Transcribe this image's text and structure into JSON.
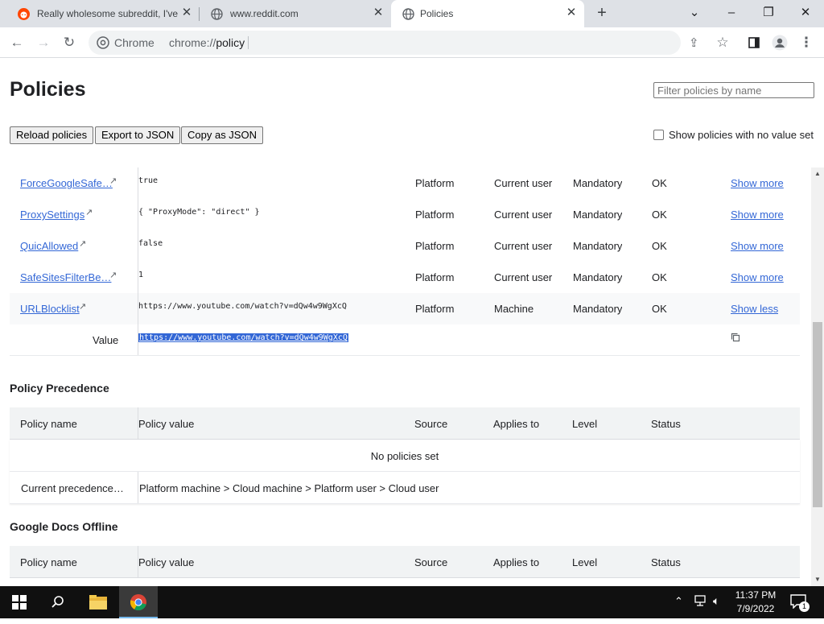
{
  "browser": {
    "tabs": [
      {
        "title": "Really wholesome subreddit, I've",
        "icon": "reddit-icon"
      },
      {
        "title": "www.reddit.com",
        "icon": "globe-icon"
      },
      {
        "title": "Policies",
        "icon": "globe-icon",
        "active": true
      }
    ],
    "omnibox": {
      "site_label": "Chrome",
      "url_prefix": "chrome://",
      "url_path": "policy"
    }
  },
  "page": {
    "title": "Policies",
    "filter_placeholder": "Filter policies by name",
    "buttons": {
      "reload": "Reload policies",
      "export": "Export to JSON",
      "copy": "Copy as JSON"
    },
    "show_no_value_label": "Show policies with no value set",
    "policies": [
      {
        "name": "ForceGoogleSafe…",
        "value": "true",
        "source": "Platform",
        "applies": "Current user",
        "level": "Mandatory",
        "status": "OK",
        "action": "Show more"
      },
      {
        "name": "ProxySettings",
        "value": "{ \"ProxyMode\": \"direct\" }",
        "source": "Platform",
        "applies": "Current user",
        "level": "Mandatory",
        "status": "OK",
        "action": "Show more"
      },
      {
        "name": "QuicAllowed",
        "value": "false",
        "source": "Platform",
        "applies": "Current user",
        "level": "Mandatory",
        "status": "OK",
        "action": "Show more"
      },
      {
        "name": "SafeSitesFilterBe…",
        "value": "1",
        "source": "Platform",
        "applies": "Current user",
        "level": "Mandatory",
        "status": "OK",
        "action": "Show more"
      },
      {
        "name": "URLBlocklist",
        "value": "https://www.youtube.com/watch?v=dQw4w9WgXcQ",
        "source": "Platform",
        "applies": "Machine",
        "level": "Mandatory",
        "status": "OK",
        "action": "Show less"
      }
    ],
    "detail": {
      "label": "Value",
      "value": "https://www.youtube.com/watch?v=dQw4w9WgXcQ"
    },
    "precedence": {
      "heading": "Policy Precedence",
      "columns": [
        "Policy name",
        "Policy value",
        "Source",
        "Applies to",
        "Level",
        "Status"
      ],
      "empty_text": "No policies set",
      "current_label": "Current precedence…",
      "current_value": "Platform machine > Cloud machine > Platform user > Cloud user"
    },
    "docs_offline": {
      "heading": "Google Docs Offline",
      "columns": [
        "Policy name",
        "Policy value",
        "Source",
        "Applies to",
        "Level",
        "Status"
      ]
    }
  },
  "taskbar": {
    "time": "11:37 PM",
    "date": "7/9/2022",
    "notification_count": "1"
  }
}
